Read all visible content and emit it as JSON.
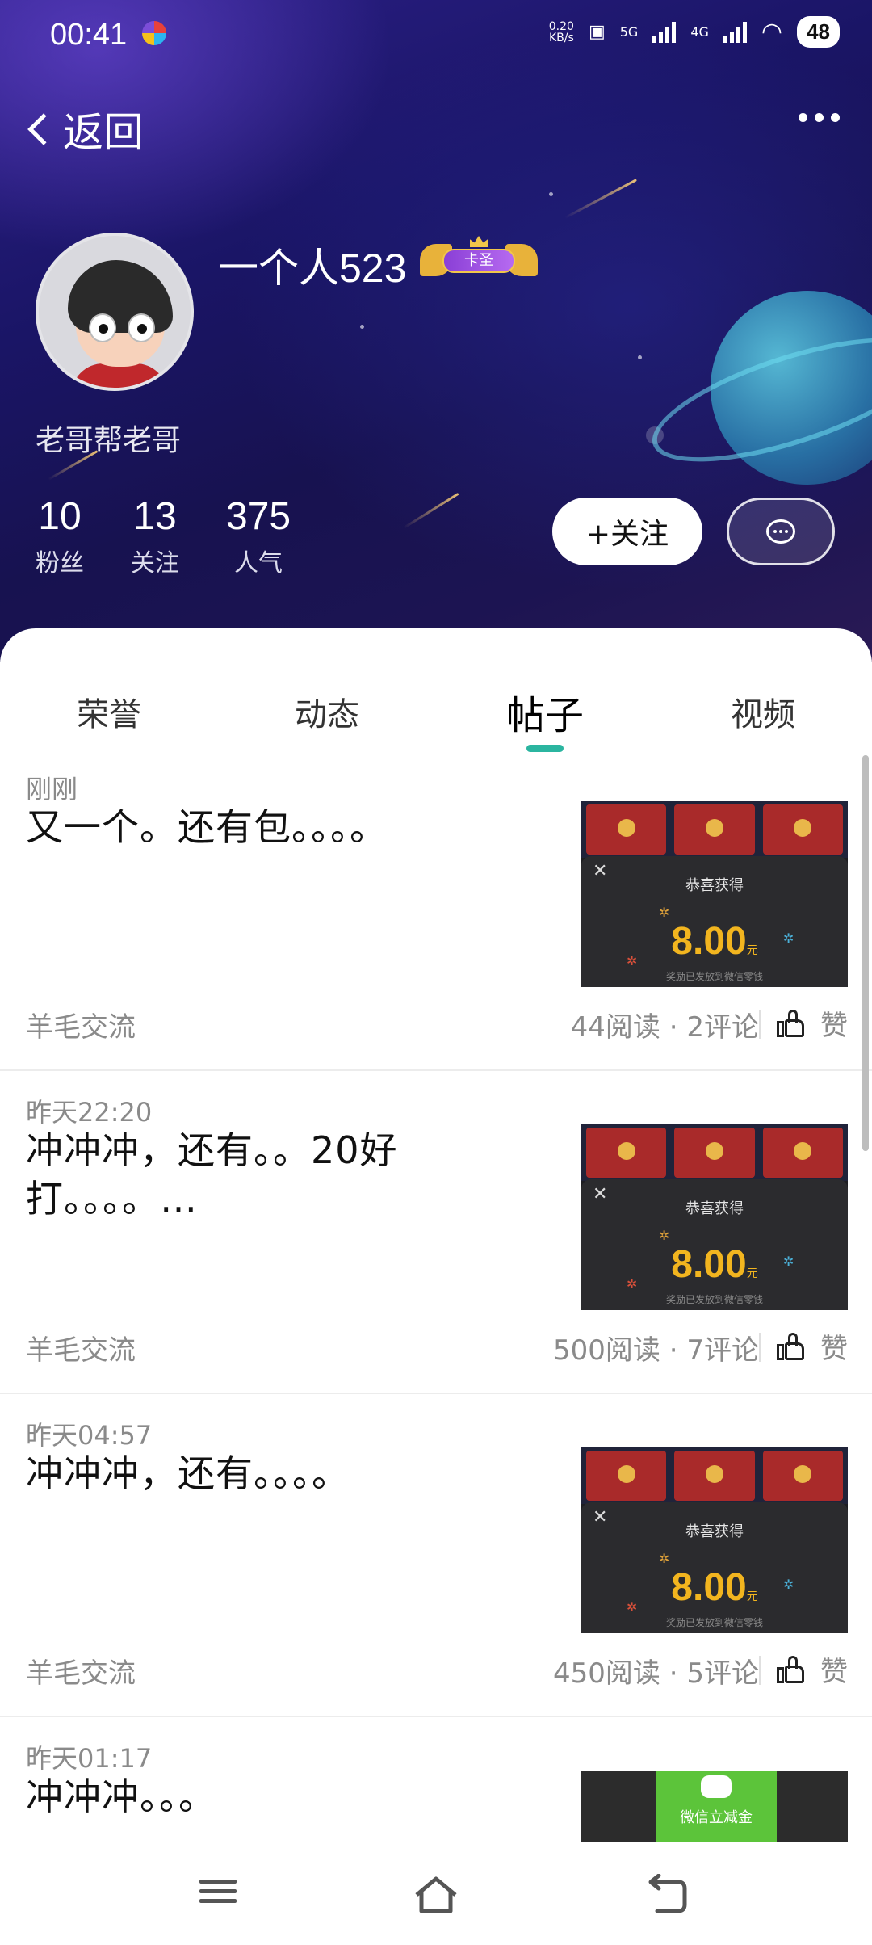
{
  "status_bar": {
    "time": "00:41",
    "net_speed": "0.20\nKB/s",
    "signal_5g": "5G",
    "signal_4g": "4G",
    "battery": "48"
  },
  "header": {
    "back_label": "返回",
    "more_icon": "more-horizontal-icon"
  },
  "profile": {
    "nickname": "一个人523",
    "badge_text": "卡圣",
    "signature": "老哥帮老哥",
    "stats": [
      {
        "value": "10",
        "label": "粉丝"
      },
      {
        "value": "13",
        "label": "关注"
      },
      {
        "value": "375",
        "label": "人气"
      }
    ],
    "follow_label": "+关注",
    "message_icon": "chat-bubble-icon"
  },
  "tabs": [
    {
      "label": "荣誉",
      "active": false
    },
    {
      "label": "动态",
      "active": false
    },
    {
      "label": "帖子",
      "active": true
    },
    {
      "label": "视频",
      "active": false
    }
  ],
  "posts": [
    {
      "time": "刚刚",
      "title": "又一个。还有包。。。。",
      "category": "羊毛交流",
      "reads": "44阅读",
      "comments": "2评论",
      "like_label": "赞",
      "thumb": {
        "dialog_title": "恭喜获得",
        "amount": "8.00",
        "unit": "元",
        "sub": "奖励已发放到微信零钱"
      }
    },
    {
      "time": "昨天22:20",
      "title": "冲冲冲，还有。。20好打。。。。…",
      "category": "羊毛交流",
      "reads": "500阅读",
      "comments": "7评论",
      "like_label": "赞",
      "thumb": {
        "dialog_title": "恭喜获得",
        "amount": "8.00",
        "unit": "元",
        "sub": "奖励已发放到微信零钱"
      }
    },
    {
      "time": "昨天04:57",
      "title": "冲冲冲，还有。。。。",
      "category": "羊毛交流",
      "reads": "450阅读",
      "comments": "5评论",
      "like_label": "赞",
      "thumb": {
        "dialog_title": "恭喜获得",
        "amount": "8.00",
        "unit": "元",
        "sub": "奖励已发放到微信零钱"
      }
    },
    {
      "time": "昨天01:17",
      "title": "冲冲冲。。。",
      "thumb_wechat_text": "微信立减金"
    }
  ],
  "meta_separator": " · ",
  "colors": {
    "accent": "#2bb5a0",
    "amount": "#f2b51f",
    "hero_bg": "#1a1566"
  }
}
